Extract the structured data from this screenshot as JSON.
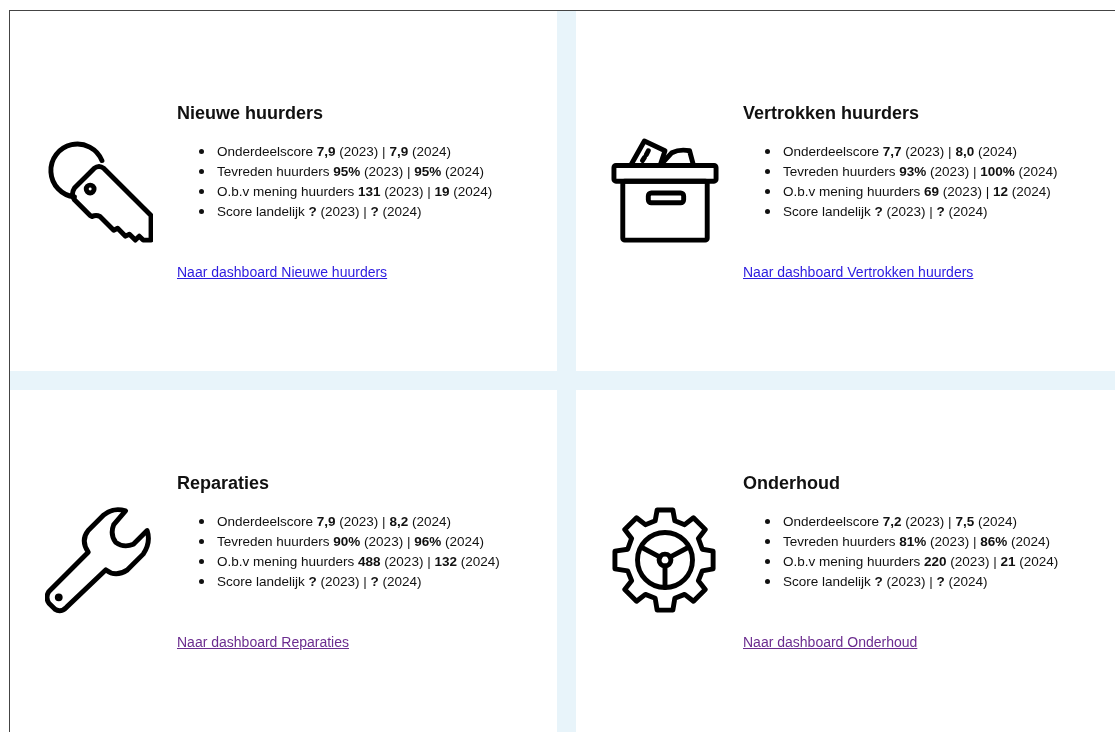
{
  "cards": [
    {
      "title": "Nieuwe huurders",
      "items": [
        "Onderdeelscore **7,9** (2023) | **7,9** (2024)",
        "Tevreden huurders **95%** (2023) | **95%** (2024)",
        "O.b.v mening huurders **131** (2023) | **19** (2024)",
        "Score landelijk **?** (2023) | **?** (2024)"
      ],
      "link": {
        "text": "Naar dashboard Nieuwe huurders",
        "visited": false
      }
    },
    {
      "title": "Vertrokken huurders",
      "items": [
        "Onderdeelscore **7,7** (2023) | **8,0** (2024)",
        "Tevreden huurders **93%** (2023) | **100%** (2024)",
        "O.b.v mening huurders **69** (2023) | **12** (2024)",
        "Score landelijk **?** (2023) | **?** (2024)"
      ],
      "link": {
        "text": "Naar dashboard Vertrokken huurders",
        "visited": false
      }
    },
    {
      "title": "Reparaties",
      "items": [
        "Onderdeelscore **7,9** (2023) | **8,2** (2024)",
        "Tevreden huurders **90%** (2023) | **96%** (2024)",
        "O.b.v mening huurders **488** (2023) | **132** (2024)",
        "Score landelijk **?** (2023) | **?** (2024)"
      ],
      "link": {
        "text": "Naar dashboard Reparaties",
        "visited": true
      }
    },
    {
      "title": "Onderhoud",
      "items": [
        "Onderdeelscore **7,2** (2023) | **7,5** (2024)",
        "Tevreden huurders **81%** (2023) | **86%** (2024)",
        "O.b.v mening huurders **220** (2023) | **21** (2024)",
        "Score landelijk **?** (2023) | **?** (2024)"
      ],
      "link": {
        "text": "Naar dashboard Onderhoud",
        "visited": true
      }
    }
  ]
}
